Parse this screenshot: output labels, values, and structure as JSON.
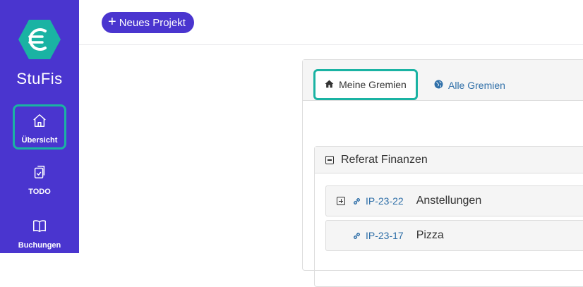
{
  "brand": {
    "name": "StuFis",
    "logo_icon": "euro-hexagon-icon",
    "logo_color": "#1ab3a3"
  },
  "sidebar": {
    "background": "#4a35cf",
    "items": [
      {
        "label": "Übersicht",
        "icon": "home-icon",
        "active": true
      },
      {
        "label": "TODO",
        "icon": "clipboard-check-icon",
        "active": false
      },
      {
        "label": "Buchungen",
        "icon": "book-open-icon",
        "active": false
      }
    ]
  },
  "topbar": {
    "new_project_label": "Neues Projekt"
  },
  "tabs": [
    {
      "label": "Meine Gremien",
      "icon": "home-icon",
      "active": true
    },
    {
      "label": "Alle Gremien",
      "icon": "globe-icon",
      "active": false
    }
  ],
  "groups": [
    {
      "title": "Referat Finanzen",
      "projects": [
        {
          "code": "IP-23-22",
          "name": "Anstellungen",
          "expandable": true
        },
        {
          "code": "IP-23-17",
          "name": "Pizza",
          "expandable": false
        }
      ]
    }
  ],
  "colors": {
    "accent": "#4a35cf",
    "highlight": "#1ab3a3",
    "link": "#2f6fa8"
  }
}
